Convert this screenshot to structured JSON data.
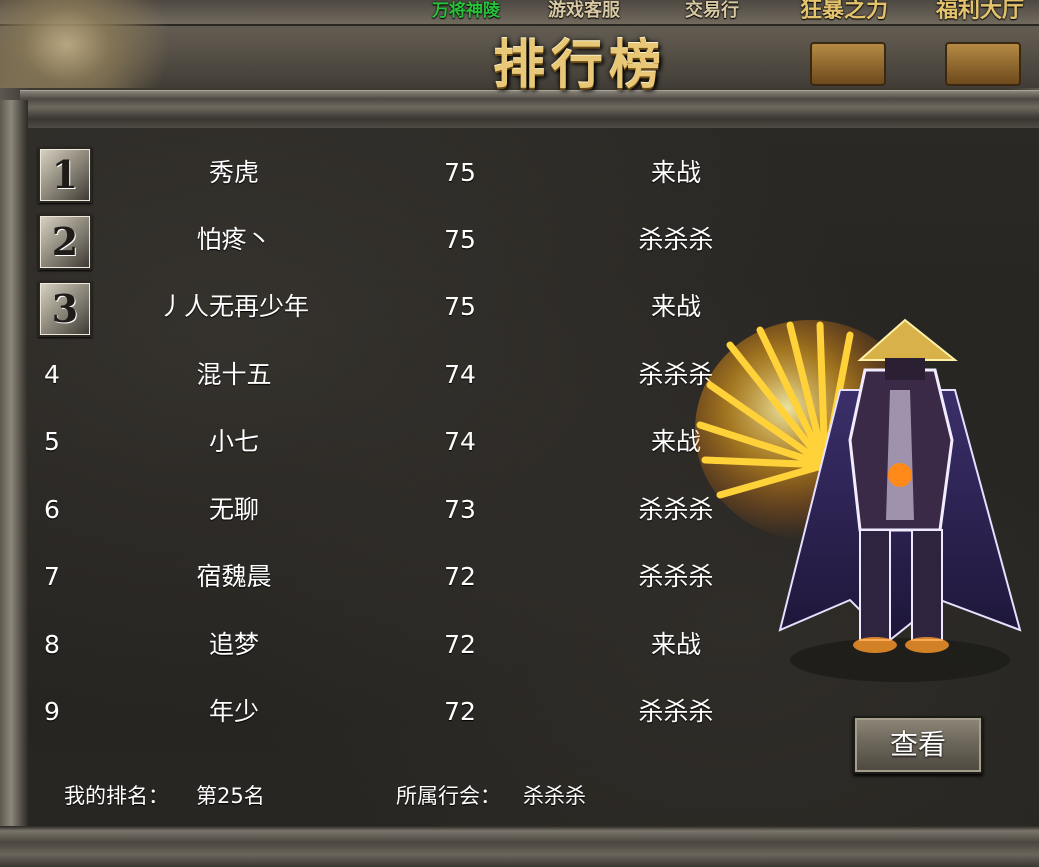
{
  "top_nav": {
    "link_1": "万将神陵",
    "link_2": "游戏客服",
    "link_3": "交易行",
    "link_4": "狂暴之力",
    "link_5": "福利大厅"
  },
  "title": "排行榜",
  "rankings": [
    {
      "rank": "1",
      "name": "秀虎",
      "level": "75",
      "guild": "来战"
    },
    {
      "rank": "2",
      "name": "怕疼丶",
      "level": "75",
      "guild": "杀杀杀"
    },
    {
      "rank": "3",
      "name": "丿人无再少年",
      "level": "75",
      "guild": "来战"
    },
    {
      "rank": "4",
      "name": "混十五",
      "level": "74",
      "guild": "杀杀杀"
    },
    {
      "rank": "5",
      "name": "小七",
      "level": "74",
      "guild": "来战"
    },
    {
      "rank": "6",
      "name": "无聊",
      "level": "73",
      "guild": "杀杀杀"
    },
    {
      "rank": "7",
      "name": "宿魏晨",
      "level": "72",
      "guild": "杀杀杀"
    },
    {
      "rank": "8",
      "name": "追梦",
      "level": "72",
      "guild": "来战"
    },
    {
      "rank": "9",
      "name": "年少",
      "level": "72",
      "guild": "杀杀杀"
    }
  ],
  "my_rank": {
    "label": "我的排名：",
    "value": "第25名"
  },
  "my_guild": {
    "label": "所属行会：",
    "value": "杀杀杀"
  },
  "view_button": "查看",
  "colors": {
    "title_gold": "#e8c777",
    "text": "#ffffff",
    "nav_gold": "#e4c36d",
    "nav_green": "#28c23a"
  }
}
